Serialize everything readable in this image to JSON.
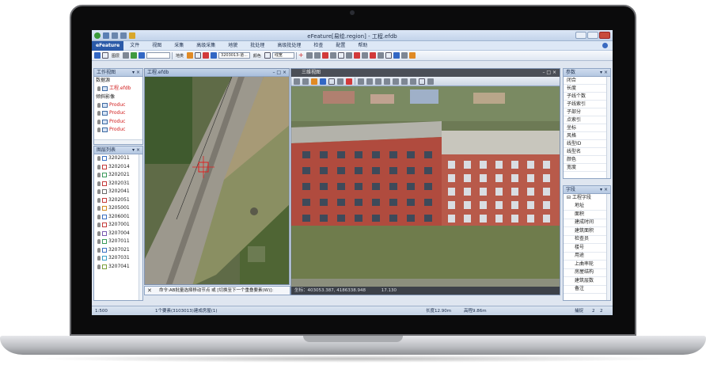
{
  "window": {
    "title": "eFeature[易绘.region] - 工程.efdb"
  },
  "menu": {
    "brand": "eFeature",
    "items": [
      "文件",
      "视图",
      "采集",
      "高级采集",
      "地貌",
      "批处理",
      "高级批处理",
      "检查",
      "配置",
      "帮助"
    ]
  },
  "toolbar": {
    "layer_label": "图层",
    "code_label": "地类",
    "code_value": "3203013-道...",
    "color_label": "颜色",
    "line_label": "线宽"
  },
  "workspace_panel": {
    "title": "工作视图",
    "data_source": "数据源",
    "project_file": "工程.efdb",
    "imagery": "倾斜影像",
    "products": [
      "Produc",
      "Produc",
      "Produc",
      "Produc"
    ]
  },
  "layer_panel": {
    "title": "图层列表",
    "layers": [
      "3202011",
      "3202014",
      "3202021",
      "3202031",
      "3202041",
      "3202051",
      "3205001",
      "3206001",
      "3207001",
      "3207004",
      "3207011",
      "3207021",
      "3207031",
      "3207041"
    ]
  },
  "map_view": {
    "tab": "工程.efdb"
  },
  "view3d": {
    "tab": "三维视图",
    "coord_prefix": "坐标：",
    "x": "403053.387",
    "y": "4186338.948",
    "z": "17.130"
  },
  "command": {
    "text": "命令:AB批量选择移动节点 或 [切换至下一个重叠要素(W)]:"
  },
  "params_panel": {
    "title": "参数",
    "rows": [
      "闭合",
      "长度",
      "子线个数",
      "子线索引",
      "子部分",
      "点索引",
      "坐标",
      "风格",
      "线型ID",
      "线型名",
      "颜色",
      "宽度"
    ]
  },
  "fields_panel": {
    "title": "字段",
    "group": "工程字段",
    "rows": [
      "地址",
      "面积",
      "建成时间",
      "建筑面积",
      "检查员",
      "楼号",
      "用途",
      "上曲率轮",
      "房屋结构",
      "建筑层数",
      "备注"
    ]
  },
  "status": {
    "scale": "1:500",
    "selection": "1个要素(3103013)建成房屋(1)",
    "length": "长度12.90m",
    "height": "高程9.86m",
    "snap": "捕捉",
    "counter_a": "2",
    "counter_b": "2"
  }
}
